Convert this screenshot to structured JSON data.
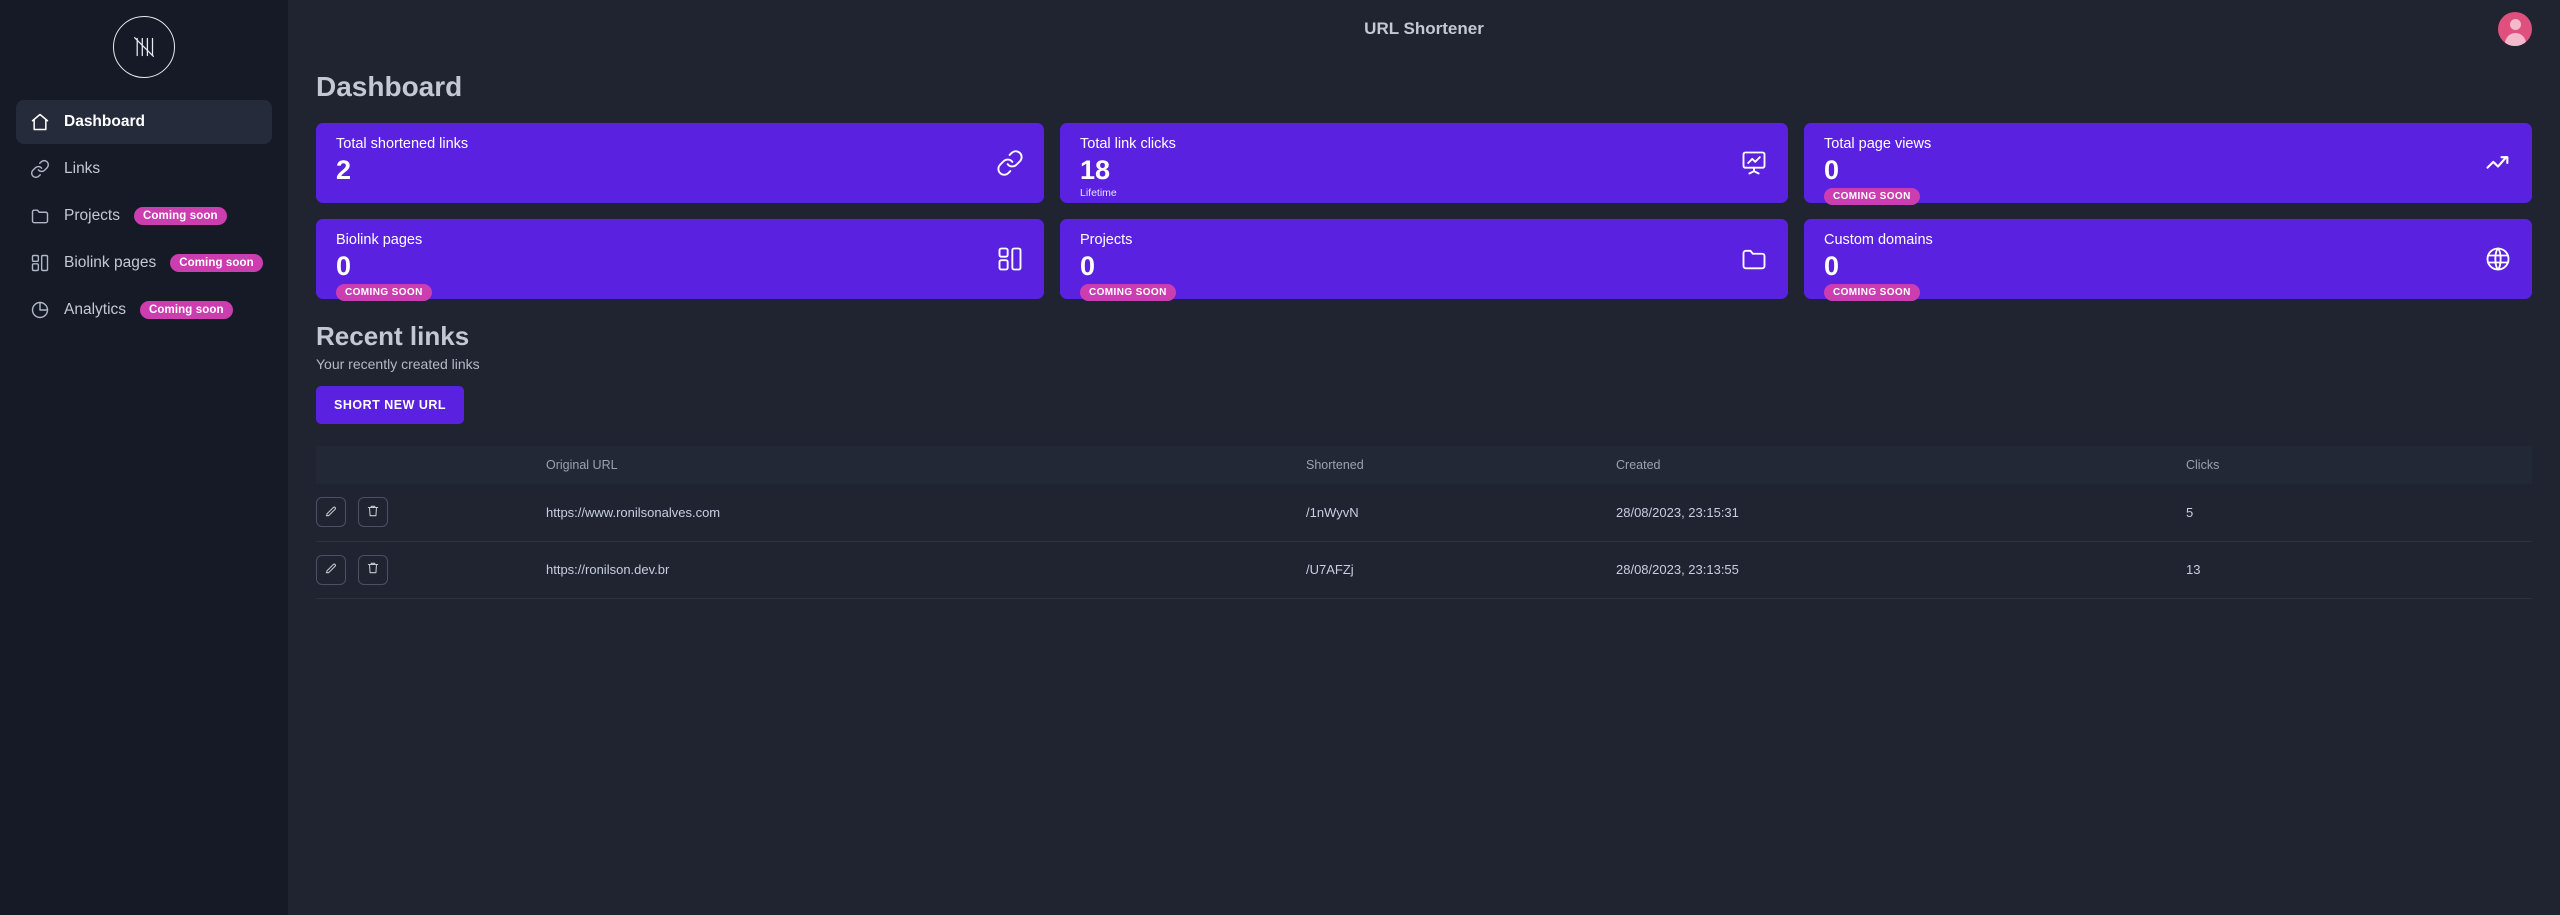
{
  "sidebar": {
    "logo_name": "tally-mark-logo",
    "items": [
      {
        "label": "Dashboard",
        "icon": "home-icon",
        "active": true,
        "badge": ""
      },
      {
        "label": "Links",
        "icon": "link-icon",
        "active": false,
        "badge": ""
      },
      {
        "label": "Projects",
        "icon": "folder-icon",
        "active": false,
        "badge": "Coming soon"
      },
      {
        "label": "Biolink pages",
        "icon": "layout-icon",
        "active": false,
        "badge": "Coming soon"
      },
      {
        "label": "Analytics",
        "icon": "pie-chart-icon",
        "active": false,
        "badge": "Coming soon"
      }
    ]
  },
  "topbar": {
    "title": "URL Shortener",
    "avatar_name": "user-avatar"
  },
  "page": {
    "title": "Dashboard"
  },
  "stats": [
    {
      "label": "Total shortened links",
      "value": "2",
      "sub": "",
      "badge": "",
      "icon": "link-icon"
    },
    {
      "label": "Total link clicks",
      "value": "18",
      "sub": "Lifetime",
      "badge": "",
      "icon": "presentation-chart-icon"
    },
    {
      "label": "Total page views",
      "value": "0",
      "sub": "",
      "badge": "COMING SOON",
      "icon": "trending-up-icon"
    },
    {
      "label": "Biolink pages",
      "value": "0",
      "sub": "",
      "badge": "COMING SOON",
      "icon": "layout-icon"
    },
    {
      "label": "Projects",
      "value": "0",
      "sub": "",
      "badge": "COMING SOON",
      "icon": "folder-icon"
    },
    {
      "label": "Custom domains",
      "value": "0",
      "sub": "",
      "badge": "COMING SOON",
      "icon": "globe-icon"
    }
  ],
  "recent": {
    "title": "Recent links",
    "subtitle": "Your recently created links",
    "button_label": "SHORT NEW URL"
  },
  "table": {
    "headers": {
      "actions": "",
      "original_url": "Original URL",
      "shortened": "Shortened",
      "created": "Created",
      "clicks": "Clicks"
    },
    "rows": [
      {
        "original_url": "https://www.ronilsonalves.com",
        "shortened": "/1nWyvN",
        "created": "28/08/2023, 23:15:31",
        "clicks": "5"
      },
      {
        "original_url": "https://ronilson.dev.br",
        "shortened": "/U7AFZj",
        "created": "28/08/2023, 23:13:55",
        "clicks": "13"
      }
    ]
  },
  "colors": {
    "accent_purple": "#5b21e0",
    "badge_pink": "#cc3db0",
    "sidebar_bg": "#151a26",
    "main_bg": "#1f2430",
    "avatar_pink": "#e0507f"
  }
}
